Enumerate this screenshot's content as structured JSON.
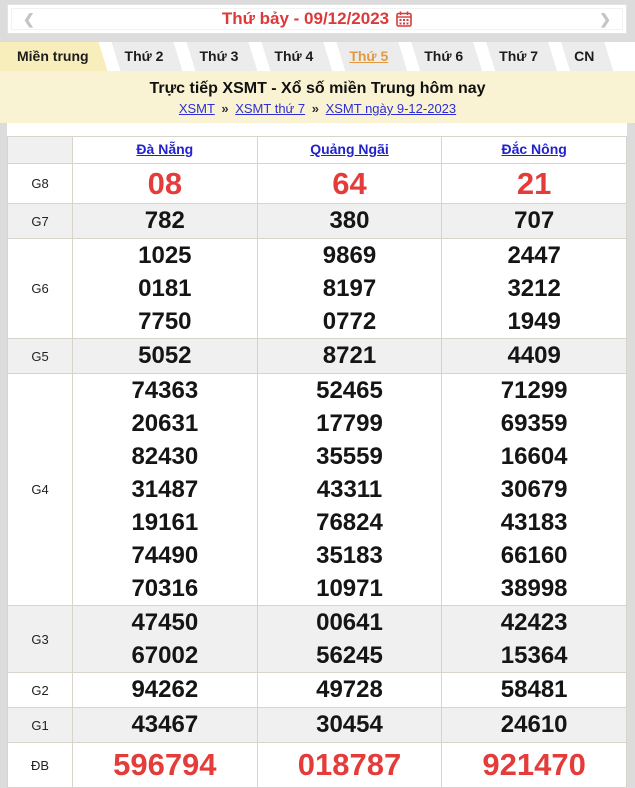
{
  "colors": {
    "accent_red": "#e43b3b",
    "link_blue": "#2222cc",
    "breadcrumb_blue": "#2e2ed3",
    "highlight_orange": "#e09a44",
    "active_tab_bg": "#f8eebc",
    "band_bg": "#faf3d3",
    "shade_row_bg": "#f0f0f0",
    "page_bg": "#dcdcdc"
  },
  "date_nav": {
    "prev": "❮",
    "next": "❯",
    "date_label": "Thứ bảy - 09/12/2023",
    "calendar_icon": "calendar"
  },
  "tabs": [
    {
      "label": "Miền trung",
      "state": "active"
    },
    {
      "label": "Thứ 2",
      "state": "normal"
    },
    {
      "label": "Thứ 3",
      "state": "normal"
    },
    {
      "label": "Thứ 4",
      "state": "normal"
    },
    {
      "label": "Thứ 5",
      "state": "highlight"
    },
    {
      "label": "Thứ 6",
      "state": "normal"
    },
    {
      "label": "Thứ 7",
      "state": "normal"
    },
    {
      "label": "CN",
      "state": "normal"
    }
  ],
  "heading": {
    "title": "Trực tiếp XSMT - Xổ số miền Trung hôm nay",
    "separator": "»",
    "breadcrumb": [
      {
        "label": "XSMT"
      },
      {
        "label": "XSMT thứ 7"
      },
      {
        "label": "XSMT ngày 9-12-2023"
      }
    ]
  },
  "results": {
    "columns": [
      "Đà Nẵng",
      "Quảng Ngãi",
      "Đắc Nông"
    ],
    "rows": [
      {
        "prize": "G8",
        "emphasis": true,
        "shade": false,
        "values": [
          [
            "08"
          ],
          [
            "64"
          ],
          [
            "21"
          ]
        ]
      },
      {
        "prize": "G7",
        "emphasis": false,
        "shade": true,
        "values": [
          [
            "782"
          ],
          [
            "380"
          ],
          [
            "707"
          ]
        ]
      },
      {
        "prize": "G6",
        "emphasis": false,
        "shade": false,
        "values": [
          [
            "1025",
            "0181",
            "7750"
          ],
          [
            "9869",
            "8197",
            "0772"
          ],
          [
            "2447",
            "3212",
            "1949"
          ]
        ]
      },
      {
        "prize": "G5",
        "emphasis": false,
        "shade": true,
        "values": [
          [
            "5052"
          ],
          [
            "8721"
          ],
          [
            "4409"
          ]
        ]
      },
      {
        "prize": "G4",
        "emphasis": false,
        "shade": false,
        "values": [
          [
            "74363",
            "20631",
            "82430",
            "31487",
            "19161",
            "74490",
            "70316"
          ],
          [
            "52465",
            "17799",
            "35559",
            "43311",
            "76824",
            "35183",
            "10971"
          ],
          [
            "71299",
            "69359",
            "16604",
            "30679",
            "43183",
            "66160",
            "38998"
          ]
        ]
      },
      {
        "prize": "G3",
        "emphasis": false,
        "shade": true,
        "values": [
          [
            "47450",
            "67002"
          ],
          [
            "00641",
            "56245"
          ],
          [
            "42423",
            "15364"
          ]
        ]
      },
      {
        "prize": "G2",
        "emphasis": false,
        "shade": false,
        "values": [
          [
            "94262"
          ],
          [
            "49728"
          ],
          [
            "58481"
          ]
        ]
      },
      {
        "prize": "G1",
        "emphasis": false,
        "shade": true,
        "values": [
          [
            "43467"
          ],
          [
            "30454"
          ],
          [
            "24610"
          ]
        ]
      },
      {
        "prize": "ĐB",
        "emphasis": true,
        "shade": false,
        "values": [
          [
            "596794"
          ],
          [
            "018787"
          ],
          [
            "921470"
          ]
        ]
      }
    ]
  }
}
